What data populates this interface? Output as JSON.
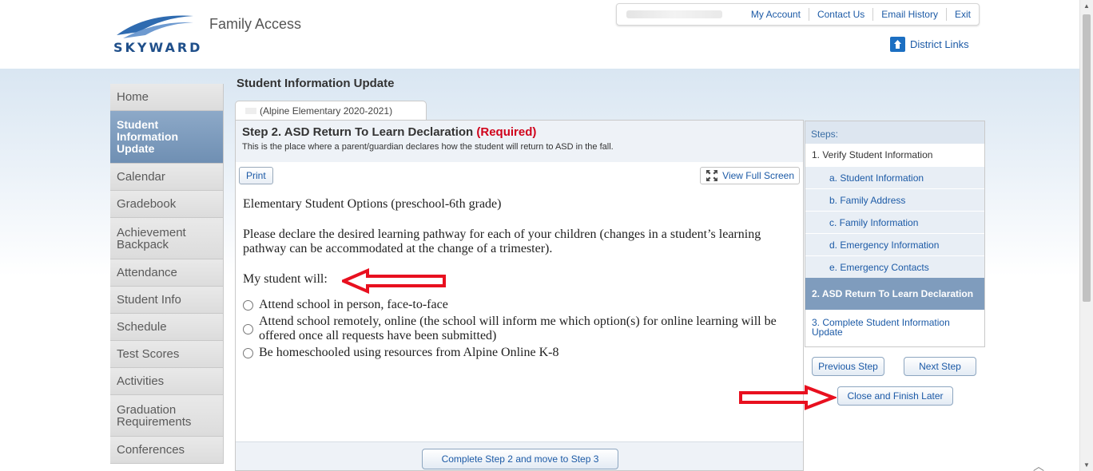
{
  "header": {
    "app_title": "Family Access",
    "logo_text": "SKYWARD",
    "links": [
      "My Account",
      "Contact Us",
      "Email History",
      "Exit"
    ],
    "district_links": "District Links"
  },
  "sidebar": {
    "items": [
      {
        "label": "Home"
      },
      {
        "label": "Student Information Update",
        "active": true
      },
      {
        "label": "Calendar"
      },
      {
        "label": "Gradebook"
      },
      {
        "label": "Achievement Backpack"
      },
      {
        "label": "Attendance"
      },
      {
        "label": "Student Info"
      },
      {
        "label": "Schedule"
      },
      {
        "label": "Test Scores"
      },
      {
        "label": "Activities"
      },
      {
        "label": "Graduation Requirements"
      },
      {
        "label": "Conferences"
      }
    ]
  },
  "main": {
    "page_title": "Student Information Update",
    "tab_label": "(Alpine Elementary 2020-2021)",
    "step_title": "Step 2. ASD Return To Learn Declaration",
    "step_required": "(Required)",
    "step_desc": "This is the place where a parent/guardian declares how the student will return to ASD in the fall.",
    "print_label": "Print",
    "fullscreen_label": "View Full Screen",
    "heading": "Elementary Student Options (preschool-6th grade)",
    "instruction": "Please declare the desired learning pathway for each of your children (changes in a student’s learning pathway can be accommodated at the change of a trimester).",
    "prompt": "My student will:",
    "options": [
      "Attend school in person, face-to-face",
      "Attend school remotely, online (the school will inform me which option(s) for online learning will be offered once all requests have been submitted)",
      "Be homeschooled using resources from Alpine Online K-8"
    ],
    "complete_button": "Complete Step 2 and move to Step 3"
  },
  "steps": {
    "header": "Steps:",
    "items": [
      {
        "label": "1. Verify Student Information",
        "kind": "main"
      },
      {
        "label": "a. Student Information",
        "kind": "sub"
      },
      {
        "label": "b. Family Address",
        "kind": "sub"
      },
      {
        "label": "c. Family Information",
        "kind": "sub"
      },
      {
        "label": "d. Emergency Information",
        "kind": "sub"
      },
      {
        "label": "e. Emergency Contacts",
        "kind": "sub"
      },
      {
        "label": "2. ASD Return To Learn Declaration",
        "kind": "current"
      },
      {
        "label": "3. Complete Student Information Update",
        "kind": "last"
      }
    ],
    "previous_button": "Previous Step",
    "next_button": "Next Step",
    "close_button": "Close and Finish Later"
  },
  "colors": {
    "accent": "#1c5aa6",
    "required": "#d0021b",
    "active_nav": "#7f9cbd",
    "annotation_arrow": "#e8101f"
  },
  "icons": [
    "district-links-icon",
    "fullscreen-icon",
    "radio-icon",
    "arrow-annotation"
  ]
}
